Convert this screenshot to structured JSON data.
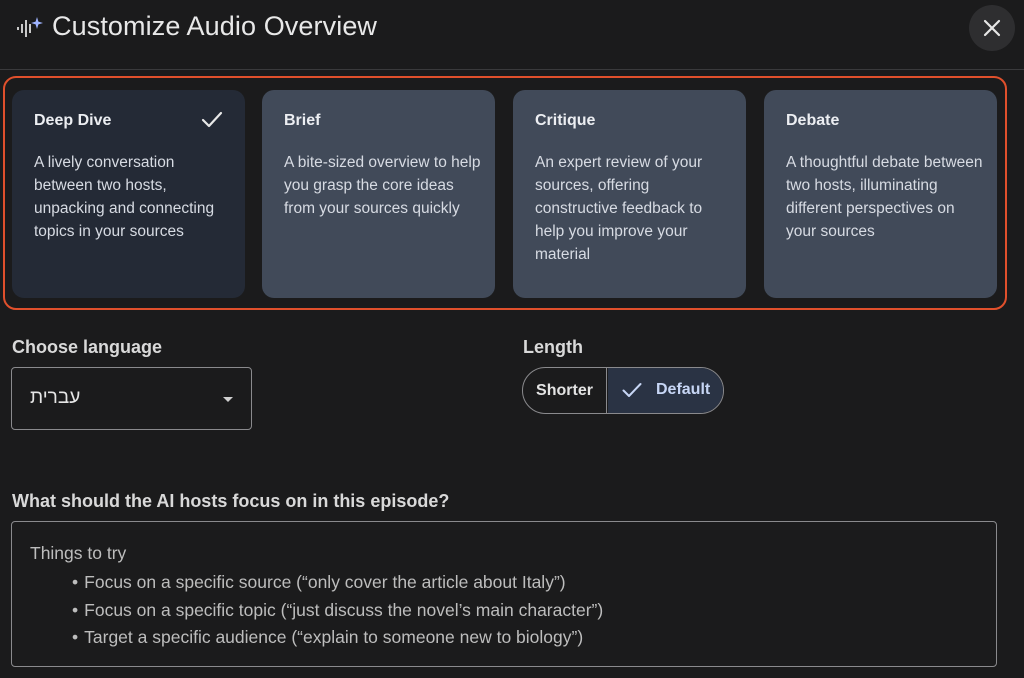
{
  "header": {
    "title": "Customize Audio Overview",
    "icon": "audio-sparkle-icon",
    "close_icon": "close-icon"
  },
  "formats": [
    {
      "title": "Deep Dive",
      "description": "A lively conversation between two hosts, unpacking and connecting topics in your sources",
      "selected": true
    },
    {
      "title": "Brief",
      "description": "A bite-sized overview to help you grasp the core ideas from your sources quickly",
      "selected": false
    },
    {
      "title": "Critique",
      "description": "An expert review of your sources, offering constructive feedback to help you improve your material",
      "selected": false
    },
    {
      "title": "Debate",
      "description": "A thoughtful debate between two hosts, illuminating different perspectives on your sources",
      "selected": false
    }
  ],
  "language": {
    "label": "Choose language",
    "value": "עברית"
  },
  "length": {
    "label": "Length",
    "options": [
      "Shorter",
      "Default"
    ],
    "selected": "Default"
  },
  "focus": {
    "label": "What should the AI hosts focus on in this episode?",
    "placeholder_heading": "Things to try",
    "placeholder_items": [
      "Focus on a specific source (“only cover the article about Italy”)",
      "Focus on a specific topic (“just discuss the novel’s main character”)",
      "Target a specific audience (“explain to someone new to biology”)"
    ]
  },
  "colors": {
    "highlight": "#e0502c",
    "card": "#414a59",
    "card_selected": "#242a36",
    "default_segment": "#2a3344"
  }
}
